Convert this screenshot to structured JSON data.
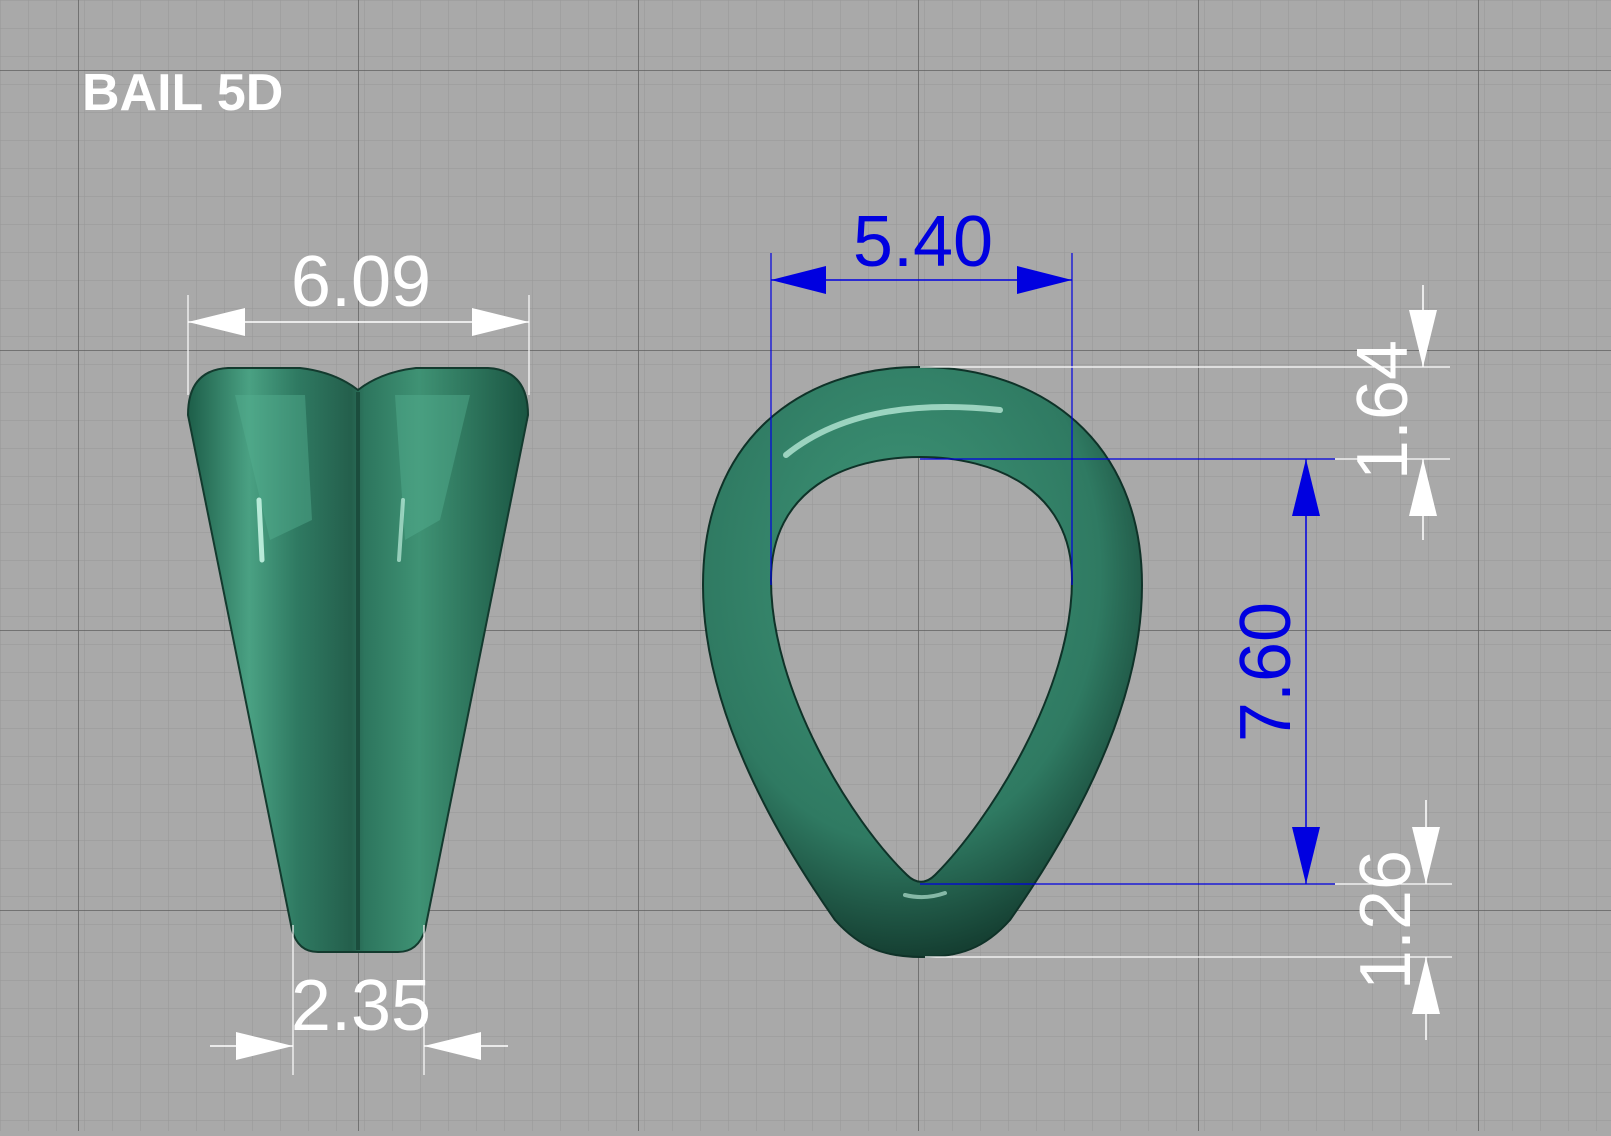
{
  "title": "BAIL 5D",
  "colors": {
    "viewport_background": "#a9a9a9",
    "grid_minor": "#979797",
    "grid_major": "#5f5f5f",
    "model_green": "#2f7a62",
    "dimension_white": "#ffffff",
    "dimension_blue": "#0000e0"
  },
  "dimensions": {
    "side_top_width": "6.09",
    "side_bottom_width": "2.35",
    "front_inner_width": "5.40",
    "front_top_thickness": "1.64",
    "front_inner_height": "7.60",
    "front_bottom_thickness": "1.26"
  }
}
